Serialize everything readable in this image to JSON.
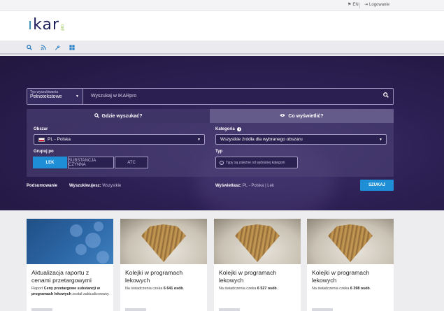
{
  "topbar": {
    "lang": "EN",
    "login": "Logowanie"
  },
  "header": {
    "logo_text": "ikar",
    "logo_sub": "pro"
  },
  "search": {
    "type_label": "Typ wyszukiwania",
    "type_value": "Pełnotekstowe",
    "placeholder": "Wyszukaj w IKARpro"
  },
  "tabs": {
    "where": "Gdzie wyszukać?",
    "what": "Co wyświetlić?"
  },
  "filters": {
    "area_label": "Obszar",
    "area_value": "PL - Polska",
    "category_label": "Kategoria",
    "category_value": "Wszystkie źródła dla wybranego obszaru",
    "group_label": "Grupuj po",
    "group_options": [
      "LEK",
      "SUBSTANCJA CZYNNA",
      "ATC"
    ],
    "type_label": "Typ",
    "type_hint": "Typy są zależne od wybranej kategorii"
  },
  "summary": {
    "title": "Podsumowanie",
    "search_label": "Wyszukiwujesz:",
    "search_value": "Wszystkie",
    "show_label": "Wyświetlasz:",
    "show_value1": "PL - Polska",
    "show_value2": "Lek",
    "submit": "SZUKAJ"
  },
  "cards": [
    {
      "title": "Aktualizacja raportu z cenami przetargowymi",
      "desc_pre": "Raport ",
      "desc_bold": "Ceny przetargowe substancji w programach lekowych",
      "desc_post": " został zaktualizowany."
    },
    {
      "title": "Kolejki w programach lekowych",
      "desc_pre": "Na świadczenia czeka ",
      "desc_bold": "6 641 osób",
      "desc_post": "."
    },
    {
      "title": "Kolejki w programach lekowych",
      "desc_pre": "Na świadczenia czeka ",
      "desc_bold": "6 527 osób",
      "desc_post": "."
    },
    {
      "title": "Kolejki w programach lekowych",
      "desc_pre": "Na świadczenia czeka ",
      "desc_bold": "6 398 osób",
      "desc_post": "."
    }
  ],
  "colors": {
    "accent": "#1e8ed6",
    "hero": "#2b1f52",
    "brand": "#1d1f5c",
    "logo_green": "#8ec03f"
  },
  "icons": [
    "flag-icon",
    "login-icon",
    "search-icon",
    "rss-icon",
    "wrench-icon",
    "grid-icon",
    "eye-icon",
    "info-icon",
    "chevron-down-icon"
  ]
}
